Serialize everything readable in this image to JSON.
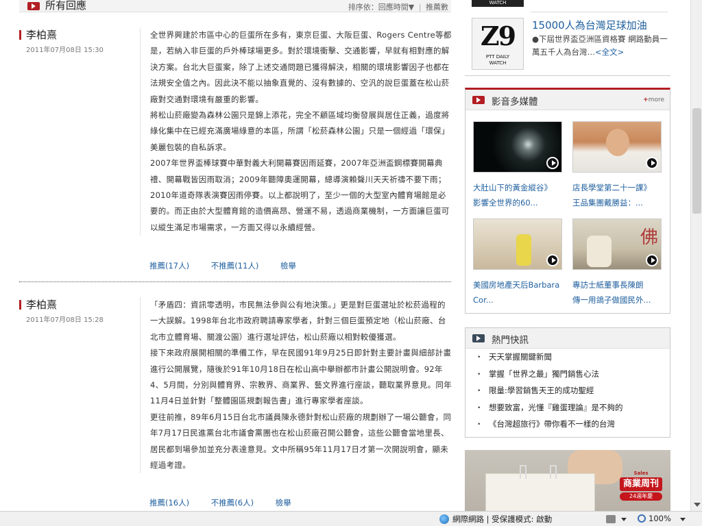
{
  "comments_section": {
    "title": "所有回應",
    "sort_label": "排序依：回應時間▼",
    "sort_alt": "推薦數"
  },
  "comments": [
    {
      "author": "李柏熹",
      "date": "2011年07月08日 15:30",
      "paragraphs": [
        "全世界興建於市區中心的巨蛋所在多有，東京巨蛋、大阪巨蛋、Rogers Centre等都是，若納入非巨蛋的戶外棒球場更多。對於環境衝擊、交通影響，早就有相對應的解決方案。台北大巨蛋案，除了上述交通問題已獲得解決，相關的環境影響因子也都在法規安全值之內。因此決不能以抽象直覺的、沒有數據的、空汎的說巨蛋蓋在松山菸廠對交通對環境有嚴重的影響。",
        "將松山菸廠變為森林公園只是錦上添花，完全不顧區域均衡發展與居住正義，過度將綠化集中在已經充滿廣場綠意的本區，所謂「松菸森林公園」只是一個經過「環保」美麗包裝的自私訴求。",
        "2007年世界盃棒球賽中華對義大利開幕賽因雨延賽，2007年亞洲盃鋼標賽開幕典禮、開幕戰皆因雨取消；2009年聽障奧運開幕，總導演賴聲川天天祈禱不要下雨；2010年道奇隊表演賽因雨停賽。以上都說明了，至少一個的大型室內體育場館是必要的。而正由於大型體育館的造價高昂、營運不易，透過商業機制，一方面讓巨蛋可以縱生滿足市場需求，一方面又得以永續經營。"
      ],
      "recommend": "推薦(17人)",
      "not_recommend": "不推薦(11人)",
      "report": "檢舉"
    },
    {
      "author": "李柏熹",
      "date": "2011年07月08日 15:28",
      "paragraphs": [
        "「矛盾四：資訊零透明，市民無法參與公有地決策。」更是對巨蛋選址於松菸過程的一大誤解。1998年台北市政府聘請專家學者，針對三個巨蛋預定地（松山菸廠、台北市立體育場、關渡公園）進行選址評估，松山菸廠以相對較優獲選。",
        "接下來政府展開相關的準備工作，早在民國91年9月25日即針對主要計畫與細部計畫進行公開展覽，隨後於91年10月18日在松山高中舉辦都市計畫公開說明會。92年4、5月間，分別與體育界、宗教界、商業界、藝文界進行座談，聽取業界意見。同年11月4日並針對「整體園區規劃報告書」進行專家學者座談。",
        "更往前推，89年6月15日台北市議員陳永德針對松山菸廠的規劃辦了一場公聽會，同年7月17日民進黨台北市議會黨團也在松山菸廠召開公聽會，這些公聽會當地里長、居民都到場參加並充分表達意見。文中所稱95年11月17日才第一次開說明會，顯未經過考證。"
      ],
      "recommend": "推薦(16人)",
      "not_recommend": "不推薦(6人)",
      "report": "檢舉"
    }
  ],
  "top_promo": {
    "logo_text": "Z9",
    "logo_caption": "PTT DAILY WATCH",
    "prev_caption": "WATCH",
    "title": "15000人為台灣足球加油",
    "desc": "●下屆世界盃亞洲區資格賽 網路動員一萬五千人為台灣…",
    "more_link": "<全文>"
  },
  "media_box": {
    "title": "影音多媒體",
    "more": "more",
    "more_prefix": "+",
    "items": [
      {
        "cap1": "大肚山下的黃金縱谷》",
        "cap2": "影響全世界的60..."
      },
      {
        "cap1": "店長學堂第二十一課》",
        "cap2": "王品集團戴勝益：..."
      },
      {
        "cap1": "美國房地產天后Barbara",
        "cap2": "Cor..."
      },
      {
        "cap1": "專訪士紙董事長陳朗",
        "cap2": "傳一用鴿子做國民外..."
      }
    ]
  },
  "hot_box": {
    "title": "熱門快訊",
    "bullet": "・",
    "items": [
      "天天掌握關鍵新聞",
      "掌握「世界之最」獨門銷售心法",
      "限量:學習銷售天王的成功聖經",
      "想要致富，光懂『雞蛋理論』是不夠的",
      "《台灣超旅行》帶你看不一樣的台灣"
    ]
  },
  "ad": {
    "badge_top": "Sales",
    "badge_main": "商業周刊",
    "badge_sub": "24週年慶"
  },
  "statusbar": {
    "security": "網際網路 | 受保護模式: 啟動",
    "zoom": "100%"
  },
  "colors": {
    "accent_red": "#b21e23",
    "link_blue": "#1f5f9e"
  }
}
